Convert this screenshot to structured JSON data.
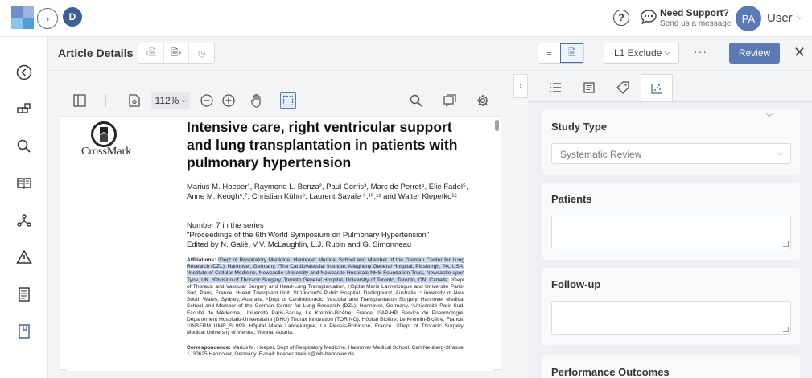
{
  "topbar": {
    "avatar_initial": "D",
    "support_title": "Need Support?",
    "support_subtitle": "Send us a message",
    "user_initials": "PA",
    "user_name": "User"
  },
  "colors": {
    "accent": "#5a79b5",
    "highlight": "#cdd8f0"
  },
  "rail": {
    "icons": [
      "back-circle-icon",
      "modules-icon",
      "search-icon",
      "book-icon",
      "network-icon",
      "warning-icon",
      "report-icon",
      "bookmark-icon"
    ]
  },
  "article_bar": {
    "title": "Article Details",
    "exclude_label": "L1 Exclude",
    "more_label": "···",
    "review_label": "Review"
  },
  "viewer": {
    "zoom": "112%",
    "page": {
      "crossmark_label": "CrossMark",
      "title": "Intensive care, right ventricular support and lung transplantation in patients with pulmonary hypertension",
      "authors": "Marius M. Hoeper¹, Raymond L. Benza², Paul Corris³, Marc de Perrot⁴, Elie Fadel⁵, Anne M. Keogh⁶,⁷, Christian Kühn⁸, Laurent Savale ⁹,¹⁰,¹¹ and Walter Klepetko¹²",
      "series_line1": "Number 7 in the series",
      "series_line2": "\"Proceedings of the 6th World Symposium on Pulmonary Hypertension\"",
      "series_line3": "Edited by N. Galiè, V.V. McLaughlin, L.J. Rubin and G. Simonneau",
      "affiliations_label": "Affiliations:",
      "affiliations_highlighted": "¹Dept of Respiratory Medicine, Hannover Medical School and Member of the German Center for Lung Research (DZL), Hannover, Germany. ²The Cardiovascular Institute, Allegheny General Hospital, Pittsburgh, PA, USA. ³Institute of Cellular Medicine, Newcastle University and Newcastle Hospitals NHS Foundation Trust, Newcastle upon Tyne, UK. ⁴Division of Thoracic Surgery, Toronto General Hospital, University of Toronto, Toronto, ON, Canada.",
      "affiliations_rest": " ⁵Dept of Thoracic and Vascular Surgery and Heart-Lung Transplantation, Hôpital Marie Lannelongue and Université Paris-Sud, Paris, France. ⁶Heart Transplant Unit, St Vincent's Public Hospital, Darlinghurst, Australia. ⁷University of New South Wales, Sydney, Australia. ⁸Dept of Cardiothoracic, Vascular and Transplantation Surgery, Hannover Medical School and Member of the German Center for Lung Research (DZL), Hannover, Germany. ⁹Université Paris-Sud, Faculté de Médecine, Université Paris-Saclay, Le Kremlin-Bicêtre, France. ¹⁰AP-HP, Service de Pneumologie, Département Hospitalo-Universitaire (DHU) Thorax Innovation (TORINO), Hôpital Bicêtre, Le Kremlin-Bicêtre, France. ¹¹INSERM UMR_S 999, Hôpital Marie Lannelongue, Le Plessis-Robinson, France. ¹²Dept of Thoracic Surgery, Medical University of Vienna, Vienna, Austria.",
      "correspondence_label": "Correspondence:",
      "correspondence_text": " Marius M. Hoeper, Dept of Respiratory Medicine, Hannover Medical School, Carl-Neuberg-Strasse 1, 30625 Hannover, Germany. E-mail: hoeper.marius@mh-hannover.de"
    }
  },
  "right_panel": {
    "study_type_label": "Study Type",
    "study_type_value": "Systematic Review",
    "patients_label": "Patients",
    "followup_label": "Follow-up",
    "performance_label": "Performance Outcomes"
  }
}
